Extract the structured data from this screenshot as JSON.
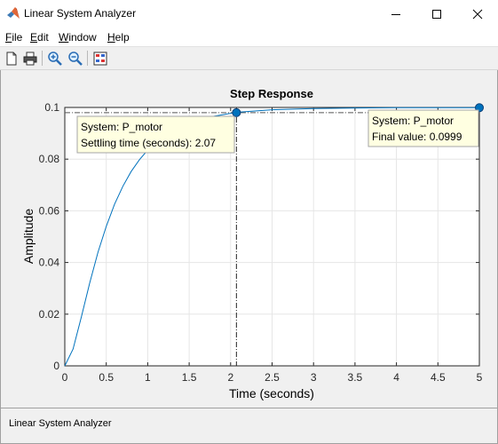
{
  "window": {
    "title": "Linear System Analyzer",
    "icon": "matlab-logo-icon"
  },
  "menu": [
    {
      "label": "File",
      "accel": "F",
      "rest": "ile"
    },
    {
      "label": "Edit",
      "accel": "E",
      "rest": "dit"
    },
    {
      "label": "Window",
      "accel": "W",
      "rest": "indow"
    },
    {
      "label": "Help",
      "accel": "H",
      "rest": "elp"
    }
  ],
  "toolbar": [
    "new-icon",
    "print-icon",
    "zoom-in-icon",
    "zoom-out-icon",
    "grid-toggle-icon"
  ],
  "chart_data": {
    "type": "line",
    "title": "Step Response",
    "xlabel": "Time (seconds)",
    "ylabel": "Amplitude",
    "xlim": [
      0,
      5
    ],
    "ylim": [
      0,
      0.1
    ],
    "xticks": [
      "0",
      "0.5",
      "1",
      "1.5",
      "2",
      "2.5",
      "3",
      "3.5",
      "4",
      "4.5",
      "5"
    ],
    "yticks": [
      "0",
      "0.02",
      "0.04",
      "0.06",
      "0.08",
      "0.1"
    ],
    "series": [
      {
        "name": "P_motor",
        "color": "#0072bd",
        "x": [
          0,
          0.1,
          0.2,
          0.3,
          0.4,
          0.5,
          0.6,
          0.7,
          0.8,
          0.9,
          1.0,
          1.2,
          1.4,
          1.6,
          1.8,
          2.07,
          2.5,
          3.0,
          3.5,
          4.0,
          4.5,
          5.0
        ],
        "y": [
          0,
          0.0065,
          0.019,
          0.032,
          0.044,
          0.054,
          0.0625,
          0.0695,
          0.0752,
          0.0798,
          0.0835,
          0.0888,
          0.0925,
          0.095,
          0.0966,
          0.0981,
          0.0991,
          0.0996,
          0.0998,
          0.0999,
          0.0999,
          0.0999
        ]
      }
    ],
    "settling_time": 2.07,
    "settling_value": 0.098,
    "final_value": 0.0999,
    "final_time": 5,
    "steady_state_band": 0.098,
    "annotations": [
      {
        "line1": "System: P_motor",
        "line2": "Settling time (seconds): 2.07"
      },
      {
        "line1": "System: P_motor",
        "line2": "Final value: 0.0999"
      }
    ]
  },
  "status": "Linear System Analyzer"
}
